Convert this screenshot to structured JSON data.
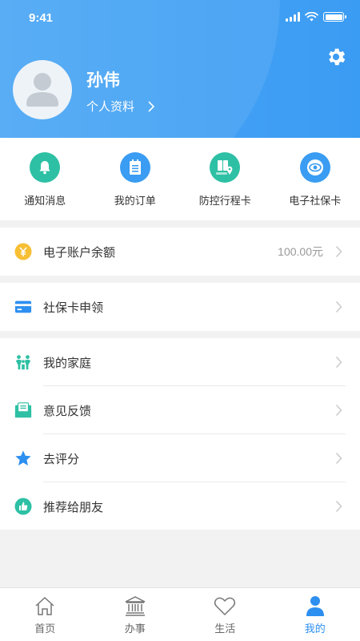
{
  "status_bar": {
    "time": "9:41"
  },
  "profile": {
    "name": "孙伟",
    "profile_link_label": "个人资料"
  },
  "quick_actions": [
    {
      "label": "通知消息",
      "icon": "bell-icon",
      "color": "#2ec0a4"
    },
    {
      "label": "我的订单",
      "icon": "order-list-icon",
      "color": "#3a9cf2"
    },
    {
      "label": "防控行程卡",
      "icon": "itinerary-card-icon",
      "color": "#2ec0a4"
    },
    {
      "label": "电子社保卡",
      "icon": "social-security-card-icon",
      "color": "#3a9cf2"
    }
  ],
  "balance": {
    "label": "电子账户余额",
    "value": "100.00元",
    "icon": "yuan-coin-icon"
  },
  "social_card": {
    "label": "社保卡申领",
    "icon": "bank-card-icon"
  },
  "menu": [
    {
      "label": "我的家庭",
      "icon": "family-icon"
    },
    {
      "label": "意见反馈",
      "icon": "feedback-mail-icon"
    },
    {
      "label": "去评分",
      "icon": "star-icon"
    },
    {
      "label": "推荐给朋友",
      "icon": "thumbs-up-icon"
    }
  ],
  "tabs": [
    {
      "label": "首页",
      "icon": "home-icon"
    },
    {
      "label": "办事",
      "icon": "government-building-icon"
    },
    {
      "label": "生活",
      "icon": "heart-icon"
    },
    {
      "label": "我的",
      "icon": "person-icon",
      "active": true
    }
  ],
  "colors": {
    "primary": "#3b9cf3",
    "teal": "#2ec0a4",
    "gold": "#f7bf34",
    "active_tab": "#2d8ff0"
  }
}
